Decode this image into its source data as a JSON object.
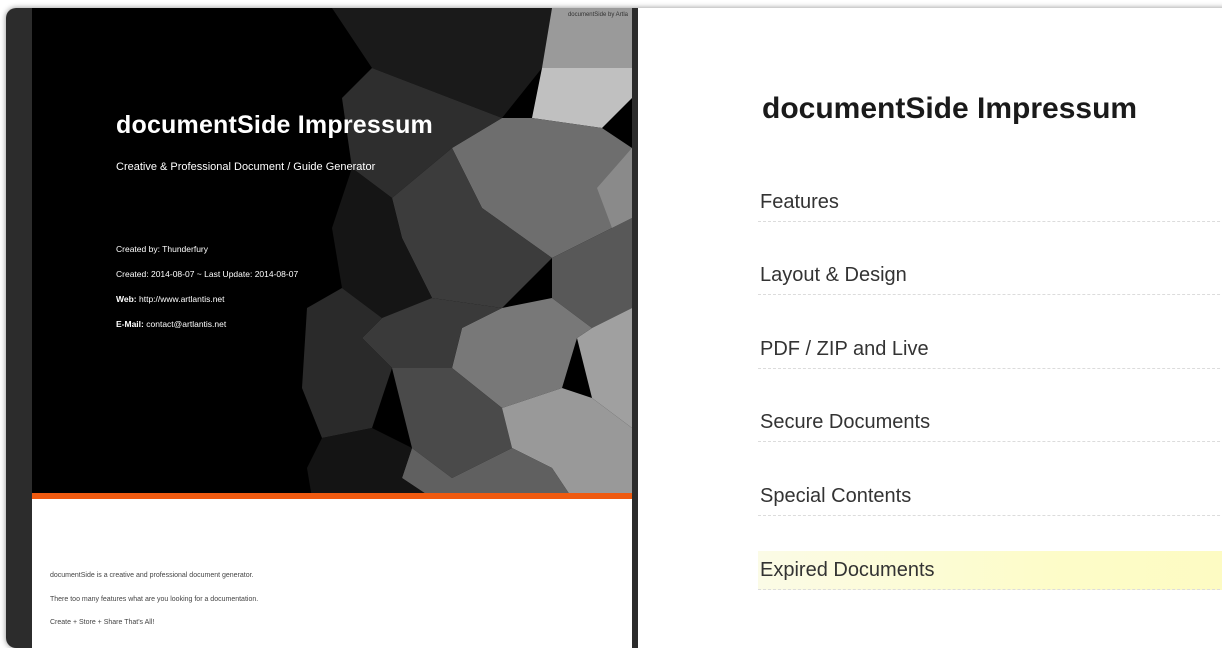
{
  "cover": {
    "credit": "documentSide by Artla",
    "title": "documentSide Impressum",
    "subtitle": "Creative & Professional Document / Guide Generator",
    "created_by_label": "Created by:",
    "created_by": "Thunderfury",
    "dates": "Created: 2014-08-07 ~ Last Update: 2014-08-07",
    "web_label": "Web:",
    "web": "http://www.artlantis.net",
    "email_label": "E-Mail:",
    "email": "contact@artlantis.net"
  },
  "intro": {
    "line1": "documentSide is a creative and professional document generator.",
    "line2": "There too many features what are you looking for a documentation.",
    "line3": "Create + Store + Share That's All!"
  },
  "toc": {
    "title": "documentSide Impressum",
    "items": [
      {
        "label": "Features"
      },
      {
        "label": "Layout & Design"
      },
      {
        "label": "PDF / ZIP and Live"
      },
      {
        "label": "Secure Documents"
      },
      {
        "label": "Special Contents"
      },
      {
        "label": "Expired Documents"
      }
    ]
  },
  "colors": {
    "accent_bar": "#ef5a10",
    "highlight": "#fdfbc2"
  }
}
